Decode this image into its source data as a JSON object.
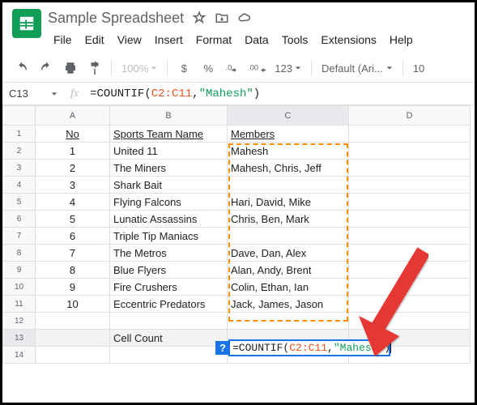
{
  "doc": {
    "title": "Sample Spreadsheet"
  },
  "menu": {
    "file": "File",
    "edit": "Edit",
    "view": "View",
    "insert": "Insert",
    "format": "Format",
    "data": "Data",
    "tools": "Tools",
    "extensions": "Extensions",
    "help": "Help"
  },
  "toolbar": {
    "zoom": "100%",
    "currency": "$",
    "percent": "%",
    "dec_dec": ".0",
    "inc_dec": ".00",
    "numfmt": "123",
    "font": "Default (Ari...",
    "fontsize": "10"
  },
  "namebox": {
    "cell": "C13",
    "fx": "fx"
  },
  "formula": {
    "prefix": "=COUNTIF",
    "open": "(",
    "range": "C2:C11",
    "comma": ",",
    "str": "\"Mahesh\"",
    "close": ")"
  },
  "cols": {
    "a": "A",
    "b": "B",
    "c": "C",
    "d": "D"
  },
  "headers": {
    "no": "No",
    "team": "Sports Team Name",
    "members": "Members"
  },
  "rows": [
    {
      "n": "1",
      "no": "1",
      "team": "United 11",
      "members": "Mahesh"
    },
    {
      "n": "2",
      "no": "2",
      "team": "The Miners",
      "members": "Mahesh, Chris, Jeff"
    },
    {
      "n": "3",
      "no": "3",
      "team": "Shark Bait",
      "members": ""
    },
    {
      "n": "4",
      "no": "4",
      "team": "Flying Falcons",
      "members": "Hari, David, Mike"
    },
    {
      "n": "5",
      "no": "5",
      "team": "Lunatic Assassins",
      "members": "Chris, Ben, Mark"
    },
    {
      "n": "6",
      "no": "6",
      "team": "Triple Tip Maniacs",
      "members": ""
    },
    {
      "n": "7",
      "no": "7",
      "team": "The Metros",
      "members": "Dave, Dan, Alex"
    },
    {
      "n": "8",
      "no": "8",
      "team": "Blue Flyers",
      "members": "Alan, Andy, Brent"
    },
    {
      "n": "9",
      "no": "9",
      "team": "Fire Crushers",
      "members": "Colin, Ethan, Ian"
    },
    {
      "n": "10",
      "no": "10",
      "team": "Eccentric Predators",
      "members": "Jack, James, Jason"
    }
  ],
  "footer": {
    "label": "Cell Count"
  },
  "hint": {
    "q": "?"
  },
  "chart_data": {
    "type": "table",
    "columns": [
      "No",
      "Sports Team Name",
      "Members"
    ],
    "rows": [
      [
        1,
        "United 11",
        "Mahesh"
      ],
      [
        2,
        "The Miners",
        "Mahesh, Chris, Jeff"
      ],
      [
        3,
        "Shark Bait",
        ""
      ],
      [
        4,
        "Flying Falcons",
        "Hari, David, Mike"
      ],
      [
        5,
        "Lunatic Assassins",
        "Chris, Ben, Mark"
      ],
      [
        6,
        "Triple Tip Maniacs",
        ""
      ],
      [
        7,
        "The Metros",
        "Dave, Dan, Alex"
      ],
      [
        8,
        "Blue Flyers",
        "Alan, Andy, Brent"
      ],
      [
        9,
        "Fire Crushers",
        "Colin, Ethan, Ian"
      ],
      [
        10,
        "Eccentric Predators",
        "Jack, James, Jason"
      ]
    ],
    "computed_label": "Cell Count",
    "formula": "=COUNTIF(C2:C11,\"Mahesh\")"
  }
}
